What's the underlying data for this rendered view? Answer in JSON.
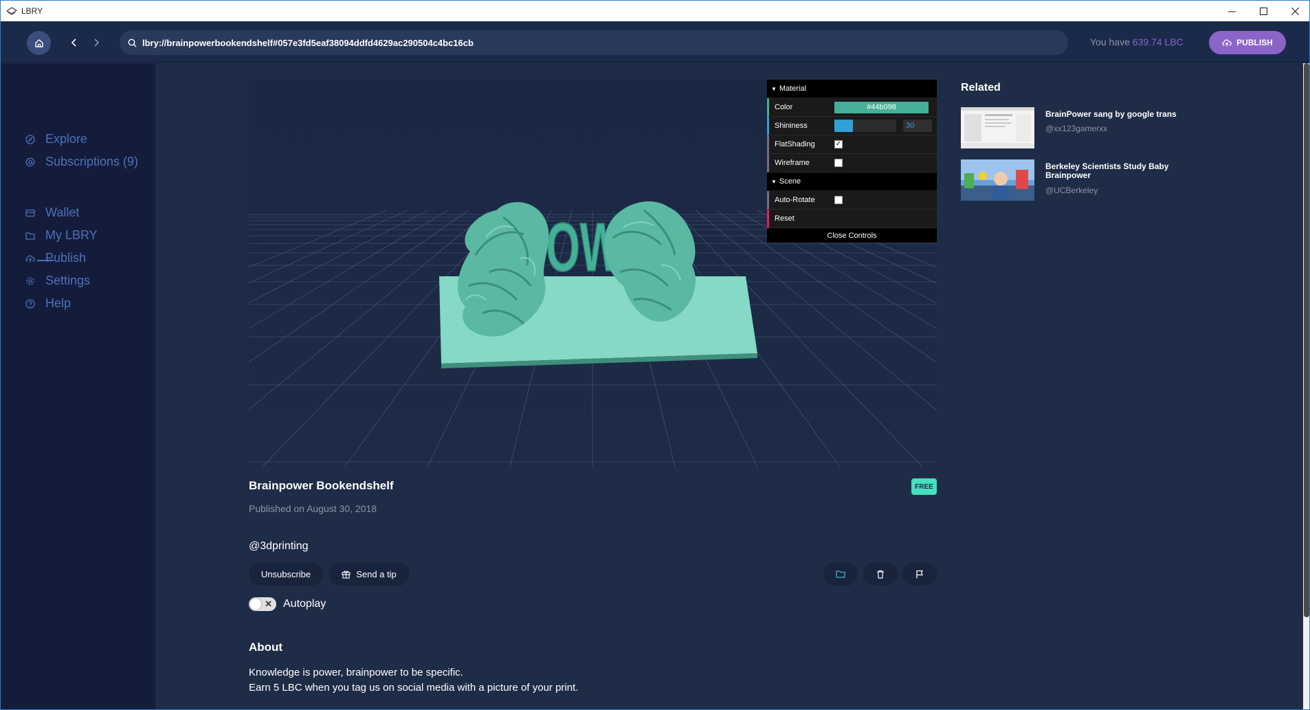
{
  "window": {
    "title": "LBRY",
    "controls": {
      "minimize": "—",
      "maximize": "☐",
      "close": "✕"
    }
  },
  "header": {
    "url": "lbry://brainpowerbookendshelf#057e3fd5eaf38094ddfd4629ac290504c4bc16cb",
    "balance_prefix": "You have ",
    "balance_amount": "639.74 LBC",
    "publish_label": "PUBLISH"
  },
  "sidebar": {
    "items": [
      {
        "label": "Explore",
        "icon": "compass-icon"
      },
      {
        "label": "Subscriptions (9)",
        "icon": "at-icon"
      },
      {
        "label": "Wallet",
        "icon": "wallet-icon"
      },
      {
        "label": "My LBRY",
        "icon": "folder-icon"
      },
      {
        "label": "Publish",
        "icon": "upload-cloud-icon"
      },
      {
        "label": "Settings",
        "icon": "gear-icon"
      },
      {
        "label": "Help",
        "icon": "help-icon"
      }
    ]
  },
  "viewer": {
    "model_text": "POWER",
    "model_color": "#44b098",
    "controls": {
      "material_folder": "Material",
      "color_label": "Color",
      "color_value": "#44b098",
      "shininess_label": "Shininess",
      "shininess_value": "30",
      "shininess_fraction": 0.3,
      "flatshading_label": "FlatShading",
      "flatshading_checked": true,
      "wireframe_label": "Wireframe",
      "wireframe_checked": false,
      "scene_folder": "Scene",
      "autorotate_label": "Auto-Rotate",
      "autorotate_checked": false,
      "reset_label": "Reset",
      "close_label": "Close Controls"
    }
  },
  "content": {
    "title": "Brainpower Bookendshelf",
    "badge": "FREE",
    "published": "Published on August 30, 2018",
    "channel": "@3dprinting",
    "unsubscribe_label": "Unsubscribe",
    "tip_label": "Send a tip",
    "autoplay_label": "Autoplay",
    "about_heading": "About",
    "about_line1": "Knowledge is power, brainpower to be specific.",
    "about_line2": "Earn 5 LBC when you tag us on social media with a picture of your print."
  },
  "related": {
    "heading": "Related",
    "items": [
      {
        "title": "BrainPower sang by google trans",
        "channel": "@xx123gamerxx"
      },
      {
        "title": "Berkeley Scientists Study Baby Brainpower",
        "channel": "@UCBerkeley"
      }
    ]
  },
  "colors": {
    "accent_purple": "#8b64c8",
    "sidebar_text": "#4c72b8",
    "free_badge": "#44e0c0",
    "background": "#1f2c47"
  }
}
